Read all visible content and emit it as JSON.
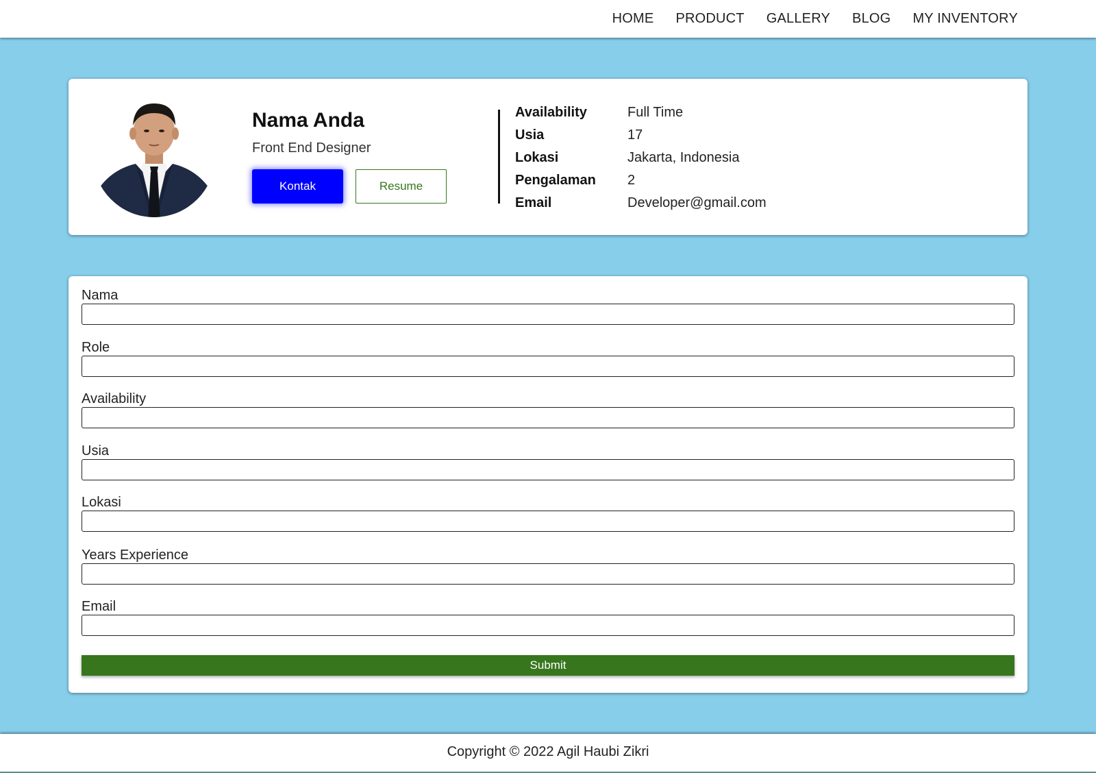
{
  "nav": {
    "items": [
      {
        "label": "HOME"
      },
      {
        "label": "PRODUCT"
      },
      {
        "label": "GALLERY"
      },
      {
        "label": "BLOG"
      },
      {
        "label": "MY INVENTORY"
      }
    ]
  },
  "profile": {
    "name": "Nama Anda",
    "role": "Front End Designer",
    "kontak_label": "Kontak",
    "resume_label": "Resume",
    "info": [
      {
        "key": "Availability",
        "value": "Full Time"
      },
      {
        "key": "Usia",
        "value": "17"
      },
      {
        "key": "Lokasi",
        "value": "Jakarta, Indonesia"
      },
      {
        "key": "Pengalaman",
        "value": "2"
      },
      {
        "key": "Email",
        "value": "Developer@gmail.com"
      }
    ]
  },
  "form": {
    "fields": [
      {
        "label": "Nama",
        "value": ""
      },
      {
        "label": "Role",
        "value": ""
      },
      {
        "label": "Availability",
        "value": ""
      },
      {
        "label": "Usia",
        "value": ""
      },
      {
        "label": "Lokasi",
        "value": ""
      },
      {
        "label": "Years Experience",
        "value": ""
      },
      {
        "label": "Email",
        "value": ""
      }
    ],
    "submit_label": "Submit"
  },
  "footer": {
    "text": "Copyright © 2022 Agil Haubi Zikri"
  },
  "colors": {
    "background": "#87ceeb",
    "kontak_button": "#0000ff",
    "accent_green": "#38761d"
  }
}
